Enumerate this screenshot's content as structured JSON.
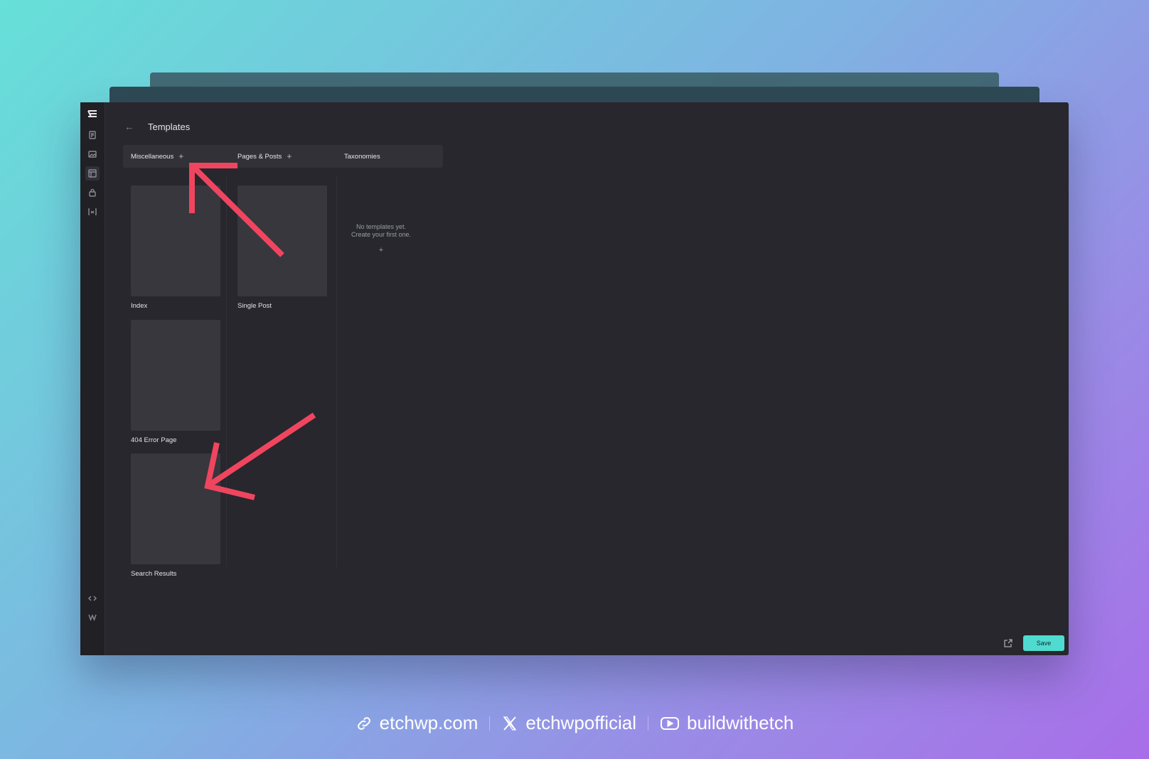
{
  "header": {
    "back_icon": "arrow-left-icon",
    "title": "Templates"
  },
  "rail": {
    "top_icons": [
      "etch-logo-icon",
      "pages-icon",
      "media-icon",
      "templates-icon",
      "lock-icon",
      "variables-icon"
    ],
    "bottom_icons": [
      "code-icon",
      "wordpress-icon"
    ]
  },
  "tabs": [
    {
      "label": "Miscellaneous",
      "add": "+"
    },
    {
      "label": "Pages & Posts",
      "add": "+"
    },
    {
      "label": "Taxonomies"
    }
  ],
  "columns": {
    "miscellaneous": [
      {
        "label": "Index"
      },
      {
        "label": "404 Error Page"
      },
      {
        "label": "Search Results"
      }
    ],
    "pages_posts": [
      {
        "label": "Single Post"
      }
    ],
    "taxonomies": {
      "empty_line1": "No templates yet.",
      "empty_line2": "Create your first one.",
      "add": "+"
    }
  },
  "bottom_bar": {
    "expand_icon": "expand-icon",
    "save_label": "Save",
    "save_color": "#4fdbd0"
  },
  "annotation_color": "#f0455f",
  "footer": {
    "website": "etchwp.com",
    "x_handle": "etchwpofficial",
    "youtube": "buildwithetch"
  }
}
